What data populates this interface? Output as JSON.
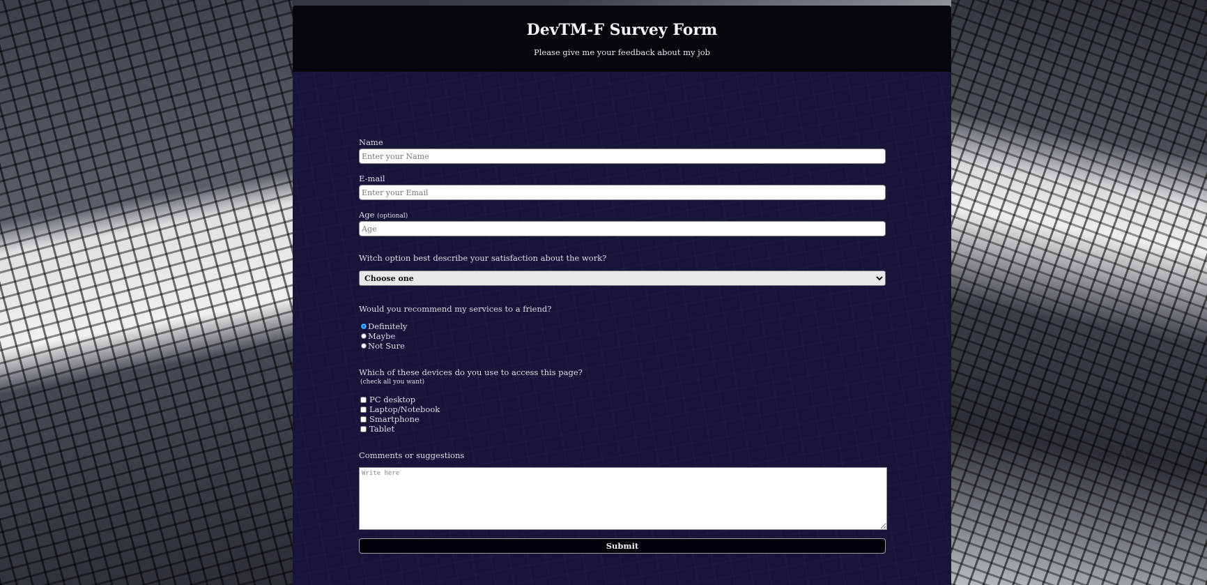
{
  "header": {
    "title": "DevTM-F Survey Form",
    "description": "Please give me your feedback about my job"
  },
  "form": {
    "name": {
      "label": "Name",
      "placeholder": "Enter your Name",
      "value": ""
    },
    "email": {
      "label": "E-mail",
      "placeholder": "Enter your Email",
      "value": ""
    },
    "age": {
      "label": "Age",
      "note": "(optional)",
      "placeholder": "Age",
      "value": ""
    },
    "satisfaction": {
      "question": "Witch option best describe your satisfaction about the work?",
      "selected": "Choose one"
    },
    "recommend": {
      "question": "Would you recommend my services to a friend?",
      "options": [
        "Definitely",
        "Maybe",
        "Not Sure"
      ],
      "checked": "Definitely"
    },
    "devices": {
      "question": "Which of these devices do you use to access this page?",
      "note": "(check all you want)",
      "options": [
        "PC desktop",
        "Laptop/Notebook",
        "Smartphone",
        "Tablet"
      ]
    },
    "comments": {
      "label": "Comments or suggestions",
      "placeholder": "Write here"
    },
    "submit_label": "Submit"
  },
  "colors": {
    "panel": "#161438",
    "header": "#06060c",
    "submit": "#02020a"
  }
}
